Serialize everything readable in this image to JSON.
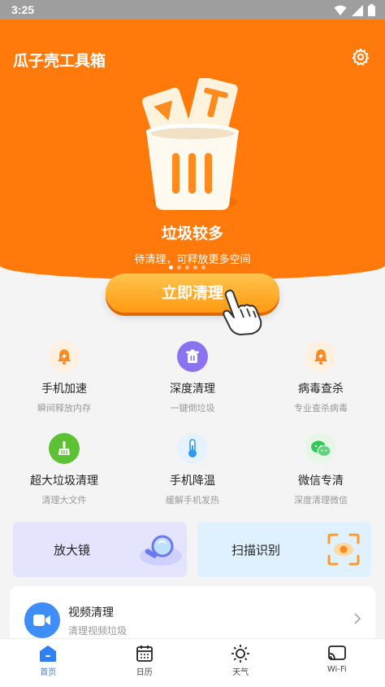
{
  "status_bar": {
    "time": "3:25"
  },
  "header": {
    "app_title": "瓜子壳工具箱"
  },
  "hero": {
    "status_title": "垃圾较多",
    "status_subtitle": "待清理，可释放更多空间",
    "carousel": {
      "total": 5,
      "active": 0
    },
    "clean_button_label": "立即清理"
  },
  "tools": [
    {
      "name": "手机加速",
      "desc": "瞬间释放内存",
      "icon": "bell-bolt-icon",
      "color": "#ff8a1e"
    },
    {
      "name": "深度清理",
      "desc": "一键倒垃圾",
      "icon": "trash-icon",
      "color": "#8a72f0"
    },
    {
      "name": "病毒查杀",
      "desc": "专业查杀病毒",
      "icon": "bell-bolt-icon",
      "color": "#ff8a1e"
    },
    {
      "name": "超大垃圾清理",
      "desc": "清理大文件",
      "icon": "broom-icon",
      "color": "#5cc233"
    },
    {
      "name": "手机降温",
      "desc": "缓解手机发热",
      "icon": "thermometer-icon",
      "color": "#2f9bf0"
    },
    {
      "name": "微信专清",
      "desc": "深度清理微信",
      "icon": "wechat-icon",
      "color": "#34c759"
    }
  ],
  "feature_cards": [
    {
      "label": "放大镜",
      "icon": "magnifier-icon",
      "bg": "#e4e4ff"
    },
    {
      "label": "扫描识别",
      "icon": "scan-icon",
      "bg": "#dff0ff"
    }
  ],
  "video_card": {
    "title": "视频清理",
    "desc": "清理视频垃圾"
  },
  "bottom_nav": [
    {
      "label": "首页",
      "icon": "home-icon",
      "active": true
    },
    {
      "label": "日历",
      "icon": "calendar-icon",
      "active": false
    },
    {
      "label": "天气",
      "icon": "sun-icon",
      "active": false
    },
    {
      "label": "Wi-Fi",
      "icon": "cast-icon",
      "active": false
    }
  ],
  "colors": {
    "brand_orange": "#ff7a0a",
    "accent_blue": "#2f7ff5"
  }
}
